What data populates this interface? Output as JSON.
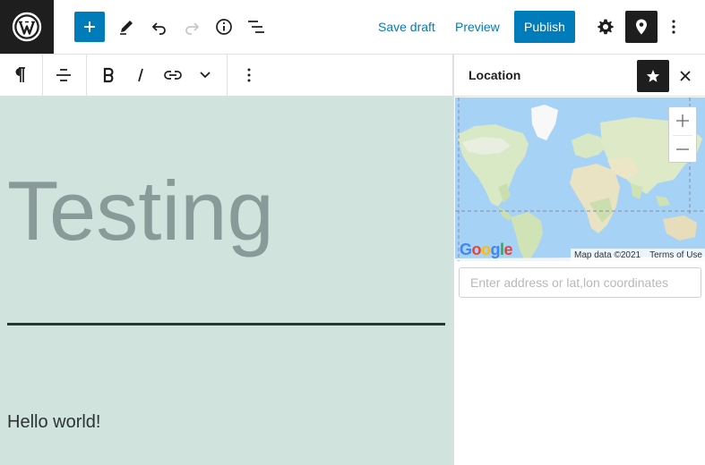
{
  "header": {
    "save_draft_label": "Save draft",
    "preview_label": "Preview",
    "publish_label": "Publish"
  },
  "content": {
    "title": "Testing",
    "paragraph": "Hello world!"
  },
  "sidebar": {
    "title": "Location",
    "map_google_logo": "Google",
    "map_data_label": "Map data ©2021",
    "map_terms_label": "Terms of Use",
    "address_placeholder": "Enter address or lat,lon coordinates",
    "address_value": ""
  },
  "colors": {
    "accent": "#007cba",
    "dark": "#1e1e1e",
    "canvas_bg": "#d0e3dd",
    "title_color": "#8a9a98",
    "map_water": "#a6d3f5"
  },
  "icons": {
    "logo": "wordpress-logo",
    "inserter": "plus-icon",
    "tools": "pencil-icon",
    "undo": "undo-icon",
    "redo": "redo-icon",
    "details": "info-icon",
    "outline": "list-view-icon",
    "settings": "gear-icon",
    "location": "map-pin-icon",
    "more": "more-vertical-icon",
    "paragraph": "pilcrow-icon",
    "align": "align-left-icon",
    "bold": "bold-icon",
    "italic": "italic-icon",
    "link": "link-icon",
    "more_formats": "chevron-down-icon",
    "star": "star-icon",
    "close": "close-icon",
    "zoom_in": "plus-icon",
    "zoom_out": "minus-icon"
  }
}
